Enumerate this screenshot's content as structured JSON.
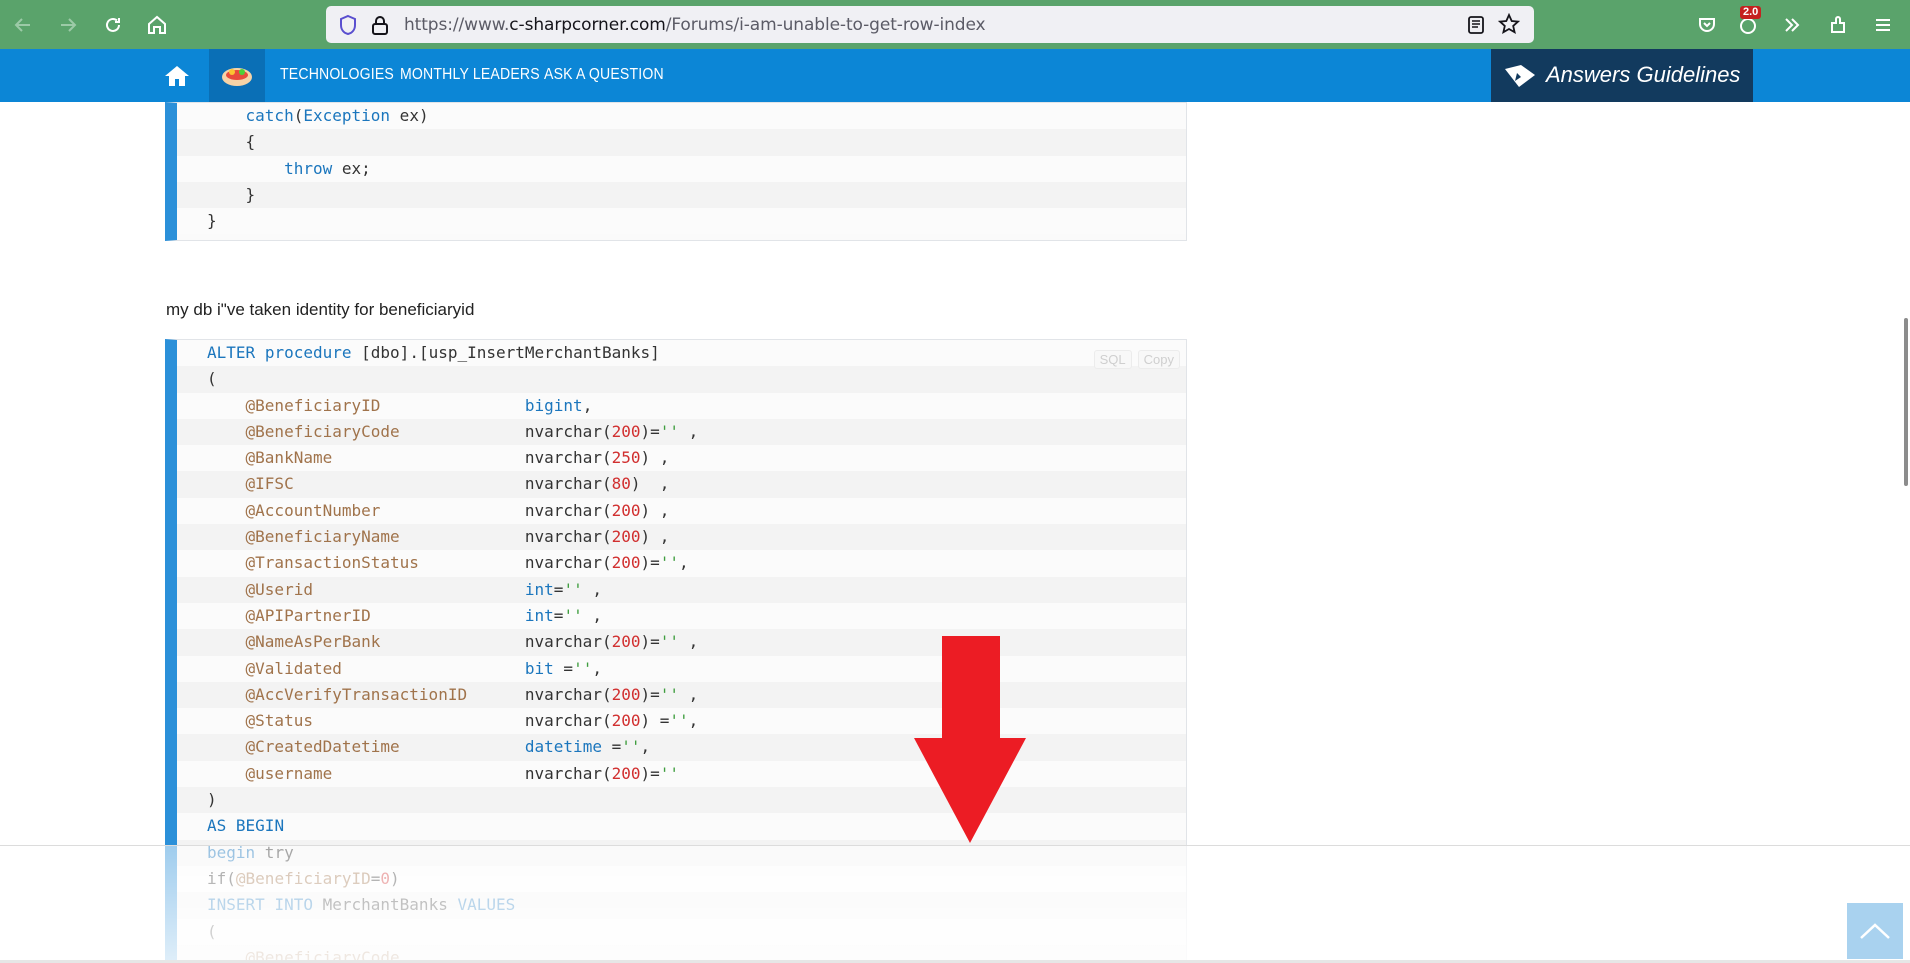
{
  "browser": {
    "url_prefix": "https://www.",
    "url_host": "c-sharpcorner.com",
    "url_path": "/Forums/i-am-unable-to-get-row-index",
    "badge": "2.0"
  },
  "site_nav": {
    "links": [
      "TECHNOLOGIES",
      "MONTHLY LEADERS",
      "ASK A QUESTION"
    ],
    "guidelines_label": "Answers Guidelines"
  },
  "top_code": {
    "lines": [
      [
        {
          "t": "    "
        },
        {
          "t": "catch",
          "c": "kw"
        },
        {
          "t": "("
        },
        {
          "t": "Exception",
          "c": "kw"
        },
        {
          "t": " ex)"
        }
      ],
      [
        {
          "t": "    {"
        }
      ],
      [
        {
          "t": "        "
        },
        {
          "t": "throw",
          "c": "kw"
        },
        {
          "t": " ex;"
        }
      ],
      [
        {
          "t": "    }"
        }
      ],
      [
        {
          "t": "}"
        }
      ]
    ]
  },
  "paragraph": "my db   i\"ve taken identity for beneficiaryid",
  "main_code": {
    "tools": [
      "SQL",
      "Copy"
    ],
    "lines": [
      [
        {
          "t": "ALTER",
          "c": "kw"
        },
        {
          "t": " "
        },
        {
          "t": "procedure",
          "c": "kw"
        },
        {
          "t": " [dbo].[usp_InsertMerchantBanks]"
        }
      ],
      [
        {
          "t": "("
        }
      ],
      [
        {
          "t": "    "
        },
        {
          "t": "@BeneficiaryID",
          "c": "var"
        },
        {
          "t": "               "
        },
        {
          "t": "bigint",
          "c": "kw"
        },
        {
          "t": ","
        }
      ],
      [
        {
          "t": "    "
        },
        {
          "t": "@BeneficiaryCode",
          "c": "var"
        },
        {
          "t": "             nvarchar("
        },
        {
          "t": "200",
          "c": "num"
        },
        {
          "t": ")="
        },
        {
          "t": "''",
          "c": "str"
        },
        {
          "t": " ,"
        }
      ],
      [
        {
          "t": "    "
        },
        {
          "t": "@BankName",
          "c": "var"
        },
        {
          "t": "                    nvarchar("
        },
        {
          "t": "250",
          "c": "num"
        },
        {
          "t": ") ,"
        }
      ],
      [
        {
          "t": "    "
        },
        {
          "t": "@IFSC",
          "c": "var"
        },
        {
          "t": "                        nvarchar("
        },
        {
          "t": "80",
          "c": "num"
        },
        {
          "t": ")  ,"
        }
      ],
      [
        {
          "t": "    "
        },
        {
          "t": "@AccountNumber",
          "c": "var"
        },
        {
          "t": "               nvarchar("
        },
        {
          "t": "200",
          "c": "num"
        },
        {
          "t": ") ,"
        }
      ],
      [
        {
          "t": "    "
        },
        {
          "t": "@BeneficiaryName",
          "c": "var"
        },
        {
          "t": "             nvarchar("
        },
        {
          "t": "200",
          "c": "num"
        },
        {
          "t": ") ,"
        }
      ],
      [
        {
          "t": "    "
        },
        {
          "t": "@TransactionStatus",
          "c": "var"
        },
        {
          "t": "           nvarchar("
        },
        {
          "t": "200",
          "c": "num"
        },
        {
          "t": ")="
        },
        {
          "t": "''",
          "c": "str"
        },
        {
          "t": ","
        }
      ],
      [
        {
          "t": "    "
        },
        {
          "t": "@Userid",
          "c": "var"
        },
        {
          "t": "                      "
        },
        {
          "t": "int",
          "c": "kw"
        },
        {
          "t": "="
        },
        {
          "t": "''",
          "c": "str"
        },
        {
          "t": " ,"
        }
      ],
      [
        {
          "t": "    "
        },
        {
          "t": "@APIPartnerID",
          "c": "var"
        },
        {
          "t": "                "
        },
        {
          "t": "int",
          "c": "kw"
        },
        {
          "t": "="
        },
        {
          "t": "''",
          "c": "str"
        },
        {
          "t": " ,"
        }
      ],
      [
        {
          "t": "    "
        },
        {
          "t": "@NameAsPerBank",
          "c": "var"
        },
        {
          "t": "               nvarchar("
        },
        {
          "t": "200",
          "c": "num"
        },
        {
          "t": ")="
        },
        {
          "t": "''",
          "c": "str"
        },
        {
          "t": " ,"
        }
      ],
      [
        {
          "t": "    "
        },
        {
          "t": "@Validated",
          "c": "var"
        },
        {
          "t": "                   "
        },
        {
          "t": "bit",
          "c": "kw"
        },
        {
          "t": " ="
        },
        {
          "t": "''",
          "c": "str"
        },
        {
          "t": ","
        }
      ],
      [
        {
          "t": "    "
        },
        {
          "t": "@AccVerifyTransactionID",
          "c": "var"
        },
        {
          "t": "      nvarchar("
        },
        {
          "t": "200",
          "c": "num"
        },
        {
          "t": ")="
        },
        {
          "t": "''",
          "c": "str"
        },
        {
          "t": " ,"
        }
      ],
      [
        {
          "t": "    "
        },
        {
          "t": "@Status",
          "c": "var"
        },
        {
          "t": "                      nvarchar("
        },
        {
          "t": "200",
          "c": "num"
        },
        {
          "t": ") ="
        },
        {
          "t": "''",
          "c": "str"
        },
        {
          "t": ","
        }
      ],
      [
        {
          "t": "    "
        },
        {
          "t": "@CreatedDatetime",
          "c": "var"
        },
        {
          "t": "             "
        },
        {
          "t": "datetime",
          "c": "kw"
        },
        {
          "t": " ="
        },
        {
          "t": "''",
          "c": "str"
        },
        {
          "t": ","
        }
      ],
      [
        {
          "t": "    "
        },
        {
          "t": "@username",
          "c": "var"
        },
        {
          "t": "                    nvarchar("
        },
        {
          "t": "200",
          "c": "num"
        },
        {
          "t": ")="
        },
        {
          "t": "''",
          "c": "str"
        }
      ],
      [
        {
          "t": ")"
        }
      ],
      [
        {
          "t": "AS",
          "c": "kw"
        },
        {
          "t": " "
        },
        {
          "t": "BEGIN",
          "c": "kw"
        }
      ],
      [
        {
          "t": "begin",
          "c": "kw"
        },
        {
          "t": " try"
        }
      ],
      [
        {
          "t": "if"
        },
        {
          "t": "("
        },
        {
          "t": "@BeneficiaryID",
          "c": "var"
        },
        {
          "t": "="
        },
        {
          "t": "0",
          "c": "num"
        },
        {
          "t": ")"
        }
      ],
      [
        {
          "t": "INSERT",
          "c": "kw"
        },
        {
          "t": " "
        },
        {
          "t": "INTO",
          "c": "kw"
        },
        {
          "t": " MerchantBanks "
        },
        {
          "t": "VALUES",
          "c": "kw"
        }
      ],
      [
        {
          "t": "("
        }
      ],
      [
        {
          "t": "    "
        },
        {
          "t": "@BeneficiaryCode",
          "c": "var"
        }
      ]
    ]
  },
  "colors": {
    "browser_green": "#5aa36b",
    "site_blue": "#0c86d6",
    "guidelines_navy": "#123a5e",
    "code_accent": "#2b90d9",
    "arrow_red": "#ec1c24"
  },
  "icons": [
    "back-icon",
    "forward-icon",
    "reload-icon",
    "home-icon",
    "shield-icon",
    "lock-icon",
    "reader-view-icon",
    "bookmark-star-icon",
    "pocket-icon",
    "extension-badge-icon",
    "overflow-chevron-icon",
    "extensions-icon",
    "menu-icon",
    "site-home-icon",
    "site-logo-icon",
    "guidelines-icon",
    "scroll-top-icon"
  ]
}
